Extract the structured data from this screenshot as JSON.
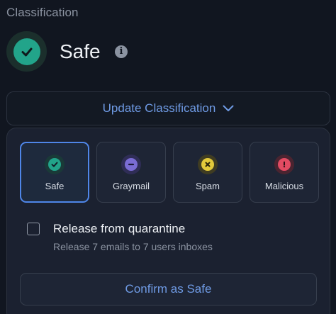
{
  "section": {
    "label": "Classification"
  },
  "status": {
    "text": "Safe",
    "icon": "check-circle-icon",
    "info_icon": "i",
    "color": "#22a48a"
  },
  "update_button": {
    "label": "Update Classification",
    "icon": "chevron-down-icon"
  },
  "options": [
    {
      "label": "Safe",
      "icon": "check-icon",
      "color": "#22a48a",
      "selected": true
    },
    {
      "label": "Graymail",
      "icon": "minus-icon",
      "color": "#7a6cd4",
      "selected": false
    },
    {
      "label": "Spam",
      "icon": "x-icon",
      "color": "#e2c93b",
      "selected": false
    },
    {
      "label": "Malicious",
      "icon": "exclamation-icon",
      "color": "#e24b62",
      "selected": false
    }
  ],
  "release": {
    "title": "Release from quarantine",
    "subtitle": "Release 7 emails to 7 users inboxes",
    "checked": false
  },
  "confirm_button": {
    "label": "Confirm as Safe"
  },
  "colors": {
    "accent": "#6f9be5",
    "selected_border": "#4f86e8"
  }
}
